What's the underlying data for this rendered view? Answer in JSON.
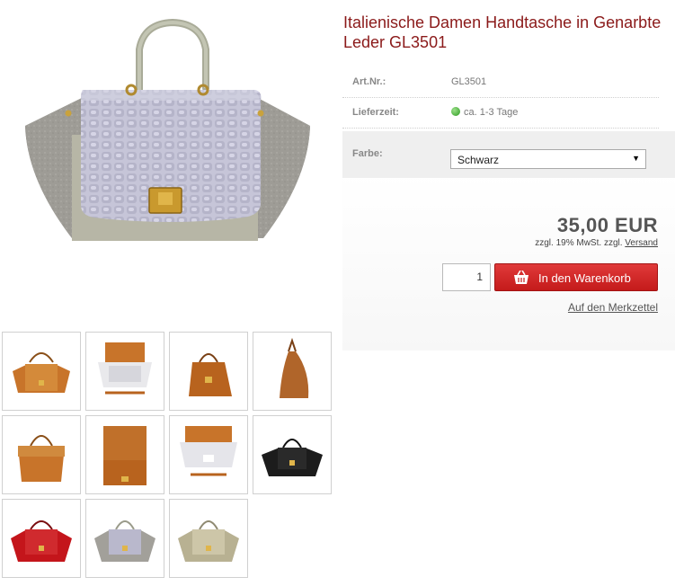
{
  "product": {
    "title": "Italienische Damen Handtasche in Genarbte Leder GL3501",
    "artnr_label": "Art.Nr.:",
    "artnr_value": "GL3501",
    "lieferzeit_label": "Lieferzeit:",
    "lieferzeit_value": "ca. 1-3 Tage",
    "farbe_label": "Farbe:",
    "farbe_selected": "Schwarz",
    "price": "35,00 EUR",
    "tax_text": "zzgl. 19% MwSt. zzgl.",
    "shipping_link": "Versand",
    "quantity": "1",
    "cart_button": "In den Warenkorb",
    "wishlist_link": "Auf den Merkzettel"
  },
  "icons": {
    "availability": "green-dot-icon",
    "cart": "shopping-basket-icon",
    "select_arrow": "triangle-down-icon"
  },
  "colors": {
    "title": "#8b1a1a",
    "cart_button": "#d02828",
    "availability": "#2c9a1f"
  },
  "thumbnails": [
    {
      "name": "thumb-cognac-front",
      "color": "#c8742a",
      "view": "front"
    },
    {
      "name": "thumb-cognac-open",
      "color": "#c8742a",
      "view": "open"
    },
    {
      "name": "thumb-cognac-angle",
      "color": "#b8631e",
      "view": "angle"
    },
    {
      "name": "thumb-cognac-side",
      "color": "#c0702a",
      "view": "side"
    },
    {
      "name": "thumb-cognac-plain",
      "color": "#c8742a",
      "view": "plain"
    },
    {
      "name": "thumb-cognac-flap",
      "color": "#c0702a",
      "view": "flap"
    },
    {
      "name": "thumb-cognac-open2",
      "color": "#c8742a",
      "view": "open"
    },
    {
      "name": "thumb-black",
      "color": "#1c1c1c",
      "view": "front"
    },
    {
      "name": "thumb-red",
      "color": "#c4151b",
      "view": "front"
    },
    {
      "name": "thumb-grey",
      "color": "#a9a8b8",
      "view": "front"
    },
    {
      "name": "thumb-beige",
      "color": "#c9c1a3",
      "view": "front"
    }
  ]
}
